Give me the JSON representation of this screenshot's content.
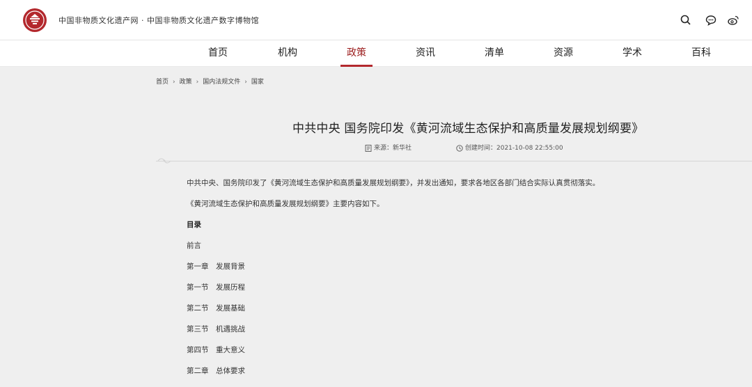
{
  "header": {
    "site_title": "中国非物质文化遗产网 · 中国非物质文化遗产数字博物馆",
    "icons": [
      "search-icon",
      "chat-icon",
      "weibo-icon"
    ]
  },
  "nav": {
    "items": [
      {
        "label": "首页"
      },
      {
        "label": "机构"
      },
      {
        "label": "政策",
        "active": true
      },
      {
        "label": "资讯"
      },
      {
        "label": "清单"
      },
      {
        "label": "资源"
      },
      {
        "label": "学术"
      },
      {
        "label": "百科"
      }
    ]
  },
  "breadcrumb": [
    "首页",
    "政策",
    "国内法规文件",
    "国家"
  ],
  "article": {
    "title": "中共中央 国务院印发《黄河流域生态保护和高质量发展规划纲要》",
    "source": "来源：新华社",
    "created": "创建时间：2021-10-08 22:55:00",
    "paragraphs": [
      {
        "text": "中共中央、国务院印发了《黄河流域生态保护和高质量发展规划纲要》，并发出通知，要求各地区各部门结合实际认真贯彻落实。"
      },
      {
        "text": "《黄河流域生态保护和高质量发展规划纲要》主要内容如下。"
      },
      {
        "text": "目录",
        "bold": true
      },
      {
        "text": "前言"
      },
      {
        "text": "第一章　发展背景"
      },
      {
        "text": "第一节　发展历程"
      },
      {
        "text": "第二节　发展基础"
      },
      {
        "text": "第三节　机遇挑战"
      },
      {
        "text": "第四节　重大意义"
      },
      {
        "text": "第二章　总体要求"
      }
    ]
  },
  "colors": {
    "accent": "#b3282d",
    "background": "#efefef",
    "header_bg": "#ffffff"
  }
}
